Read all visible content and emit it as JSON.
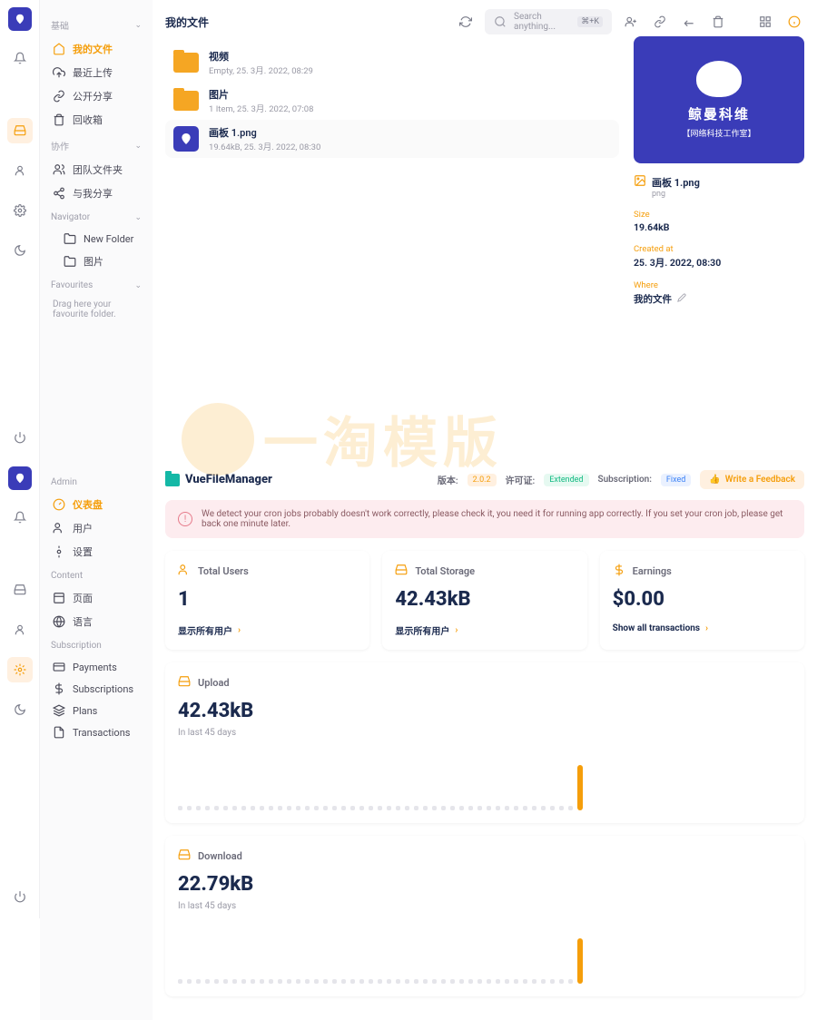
{
  "screen1": {
    "page_title": "我的文件",
    "search_placeholder": "Search anything...",
    "search_kbd": "⌘+K",
    "sidebar": {
      "section_basic": "基础",
      "items_basic": [
        {
          "label": "我的文件",
          "icon": "home"
        },
        {
          "label": "最近上传",
          "icon": "upload-cloud"
        },
        {
          "label": "公开分享",
          "icon": "link"
        },
        {
          "label": "回收箱",
          "icon": "trash"
        }
      ],
      "section_collab": "协作",
      "items_collab": [
        {
          "label": "团队文件夹",
          "icon": "users"
        },
        {
          "label": "与我分享",
          "icon": "share"
        }
      ],
      "section_nav": "Navigator",
      "items_nav": [
        {
          "label": "New Folder",
          "icon": "folder"
        },
        {
          "label": "图片",
          "icon": "folder"
        }
      ],
      "section_fav": "Favourites",
      "fav_hint": "Drag here your favourite folder."
    },
    "files": [
      {
        "name": "视频",
        "meta": "Empty, 25. 3月. 2022, 08:29",
        "type": "folder"
      },
      {
        "name": "图片",
        "meta": "1 Item, 25. 3月. 2022, 07:08",
        "type": "folder"
      },
      {
        "name": "画板 1.png",
        "meta": "19.64kB, 25. 3月. 2022, 08:30",
        "type": "image"
      }
    ],
    "preview": {
      "brand_cn": "鲸曼科维",
      "brand_sub": "【网络科技工作室】",
      "filename": "画板 1.png",
      "ext": "png",
      "size_label": "Size",
      "size": "19.64kB",
      "created_label": "Created at",
      "created": "25. 3月. 2022, 08:30",
      "where_label": "Where",
      "where": "我的文件"
    }
  },
  "screen2": {
    "brand": "VueFileManager",
    "version_label": "版本:",
    "version": "2.0.2",
    "license_label": "许可证:",
    "license": "Extended",
    "subscription_label": "Subscription:",
    "subscription": "Fixed",
    "feedback": "Write a Feedback",
    "alert": "We detect your cron jobs probably doesn't work correctly, please check it, you need it for running app correctly. If you set your cron job, please get back one minute later.",
    "sidebar": {
      "section_admin": "Admin",
      "items_admin": [
        {
          "label": "仪表盘"
        },
        {
          "label": "用户"
        },
        {
          "label": "设置"
        }
      ],
      "section_content": "Content",
      "items_content": [
        {
          "label": "页面"
        },
        {
          "label": "语言"
        }
      ],
      "section_sub": "Subscription",
      "items_sub": [
        {
          "label": "Payments"
        },
        {
          "label": "Subscriptions"
        },
        {
          "label": "Plans"
        },
        {
          "label": "Transactions"
        }
      ]
    },
    "cards": {
      "users": {
        "title": "Total Users",
        "value": "1",
        "link": "显示所有用户"
      },
      "storage": {
        "title": "Total Storage",
        "value": "42.43kB",
        "link": "显示所有用户"
      },
      "earnings": {
        "title": "Earnings",
        "value": "$0.00",
        "link": "Show all transactions"
      }
    },
    "upload": {
      "title": "Upload",
      "value": "42.43kB",
      "sub": "In last 45 days"
    },
    "download": {
      "title": "Download",
      "value": "22.79kB",
      "sub": "In last 45 days"
    }
  },
  "watermark": "一淘模版",
  "chart_data": [
    {
      "type": "bar",
      "title": "Upload",
      "ylabel": "",
      "categories_count": 45,
      "values_nonzero_last": 42.43,
      "note": "Only last day has value ~42.43kB; all prior ~0"
    },
    {
      "type": "bar",
      "title": "Download",
      "ylabel": "",
      "categories_count": 45,
      "values_nonzero_last": 22.79,
      "note": "Only last day has value ~22.79kB; all prior ~0"
    }
  ]
}
